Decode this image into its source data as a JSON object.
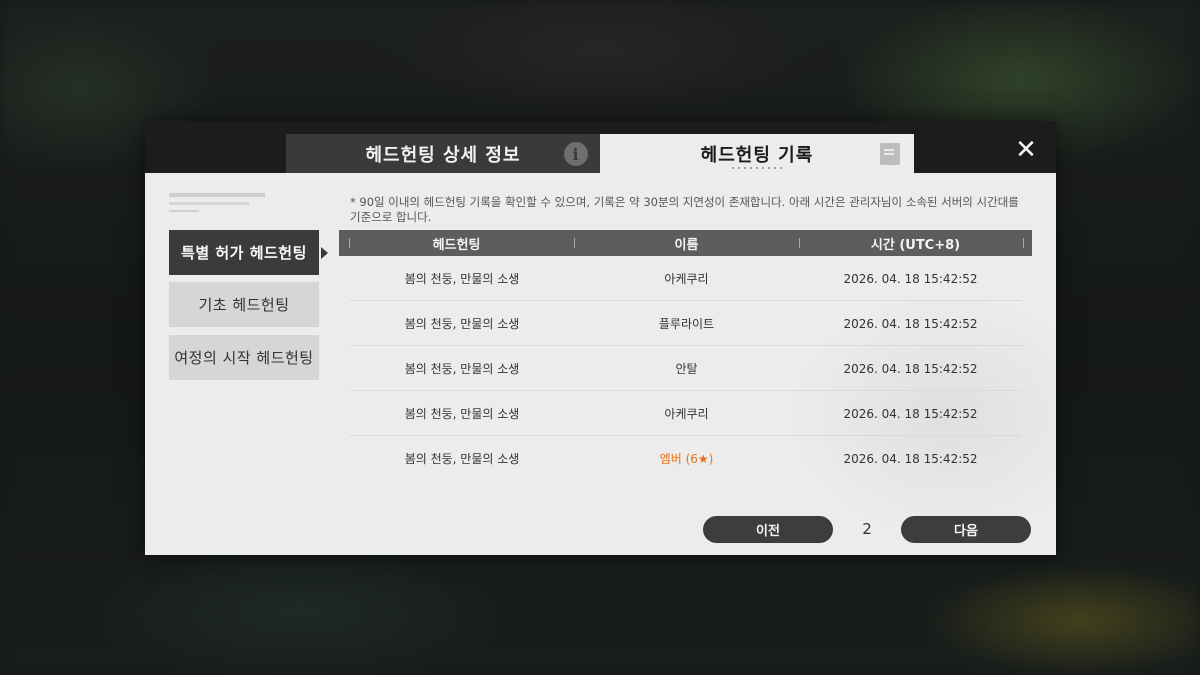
{
  "tabs": {
    "info_label": "헤드헌팅 상세 정보",
    "record_label": "헤드헌팅 기록",
    "info_icon": "i"
  },
  "close_icon": "✕",
  "nav": {
    "items": [
      {
        "label": "특별 허가 헤드헌팅",
        "active": true
      },
      {
        "label": "기초 헤드헌팅",
        "active": false
      },
      {
        "label": "여정의 시작 헤드헌팅",
        "active": false
      }
    ]
  },
  "notice": "* 90일 이내의 헤드헌팅 기록을 확인할 수 있으며, 기록은 약 30분의 지연성이 존재합니다. 아래 시간은 관리자님이 소속된 서버의 시간대를 기준으로 합니다.",
  "table": {
    "headers": [
      "헤드헌팅",
      "이름",
      "시간 (UTC+8)"
    ],
    "rows": [
      {
        "banner": "봄의 천둥, 만물의 소생",
        "name": "아케쿠리",
        "time": "2026. 04. 18 15:42:52"
      },
      {
        "banner": "봄의 천둥, 만물의 소생",
        "name": "플루라이트",
        "time": "2026. 04. 18 15:42:52"
      },
      {
        "banner": "봄의 천둥, 만물의 소생",
        "name": "안탈",
        "time": "2026. 04. 18 15:42:52"
      },
      {
        "banner": "봄의 천둥, 만물의 소생",
        "name": "아케쿠리",
        "time": "2026. 04. 18 15:42:52"
      },
      {
        "banner": "봄의 천둥, 만물의 소생",
        "name": "엠버 (6★)",
        "time": "2026. 04. 18 15:42:52"
      }
    ],
    "highlight_color": "#e8701a"
  },
  "pagination": {
    "prev_label": "이전",
    "page": "2",
    "next_label": "다음"
  }
}
